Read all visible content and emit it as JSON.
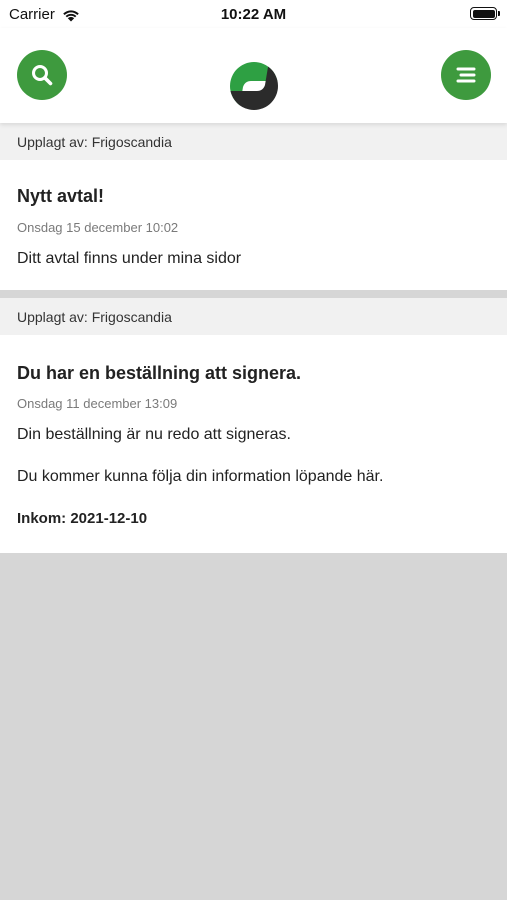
{
  "status_bar": {
    "carrier": "Carrier",
    "time": "10:22 AM"
  },
  "header": {
    "search_icon": "search-icon",
    "menu_icon": "menu-icon",
    "logo": "frigoscandia-logo",
    "accent_color": "#3e9a3e"
  },
  "posts": [
    {
      "posted_by": "Upplagt av: Frigoscandia",
      "title": "Nytt avtal!",
      "date": "Onsdag 15 december 10:02",
      "paragraphs": [
        "Ditt avtal finns under mina sidor"
      ]
    },
    {
      "posted_by": "Upplagt av: Frigoscandia",
      "title": "Du har en beställning att signera.",
      "date": "Onsdag 11 december 13:09",
      "paragraphs": [
        "Din beställning är nu redo att signeras.",
        "Du kommer kunna följa din information löpande här."
      ],
      "received": "Inkom: 2021-12-10"
    }
  ]
}
